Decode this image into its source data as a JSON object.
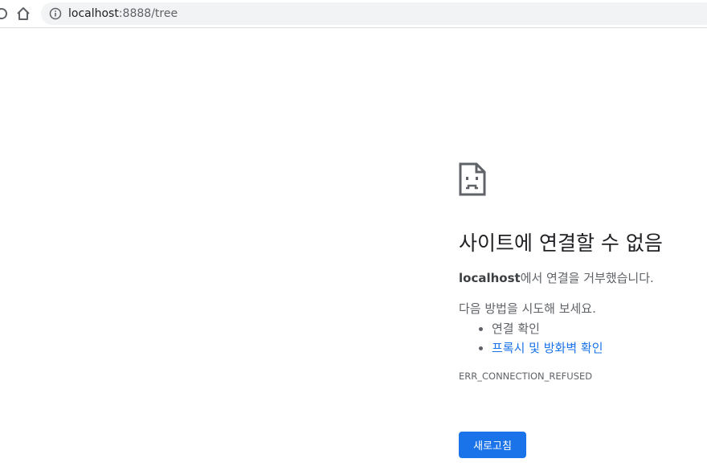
{
  "browser": {
    "url_host": "localhost",
    "url_rest": ":8888/tree"
  },
  "error": {
    "heading": "사이트에 연결할 수 없음",
    "host": "localhost",
    "message_suffix": "에서 연결을 거부했습니다.",
    "suggest_intro": "다음 방법을 시도해 보세요.",
    "suggestions": [
      {
        "label": "연결 확인",
        "is_link": false
      },
      {
        "label": "프록시 및 방화벽 확인",
        "is_link": true
      }
    ],
    "code": "ERR_CONNECTION_REFUSED",
    "reload_label": "새로고침"
  },
  "colors": {
    "accent": "#1a73e8",
    "text_primary": "#202124",
    "text_secondary": "#5f6368",
    "omnibox_bg": "#f1f3f4"
  },
  "icons": {
    "reload": "reload-icon",
    "home": "home-icon",
    "info": "info-icon",
    "sad_page": "sad-page-icon"
  }
}
